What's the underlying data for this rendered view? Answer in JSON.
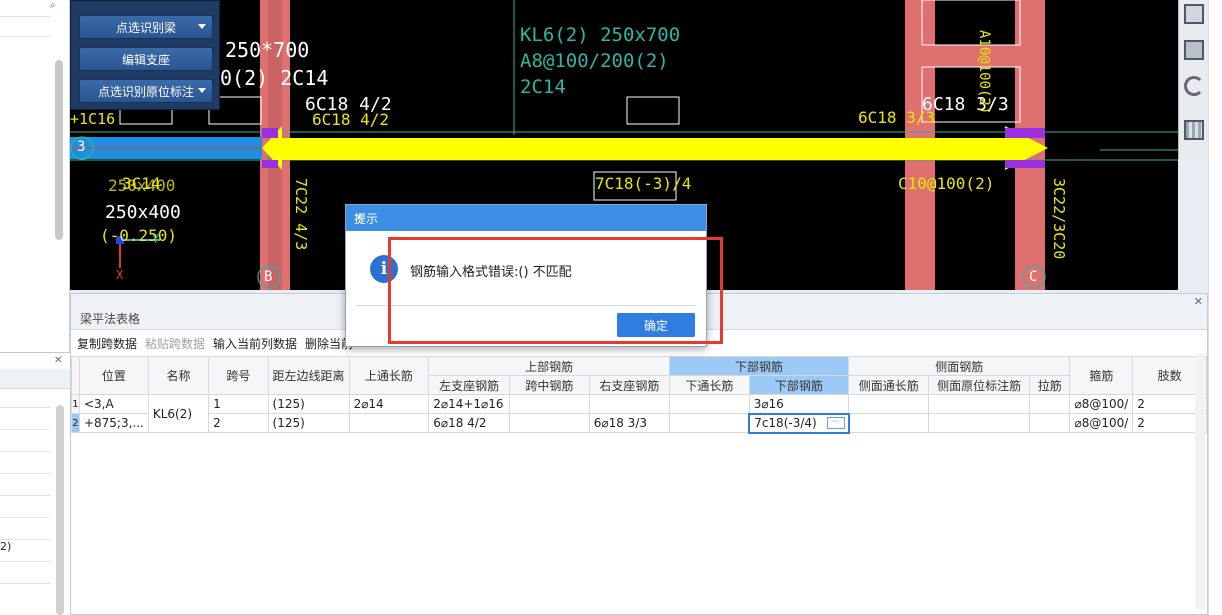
{
  "floating_menu": {
    "items": [
      {
        "label": "点选识别梁",
        "has_dropdown": true
      },
      {
        "label": "编辑支座",
        "has_dropdown": false
      },
      {
        "label": "点选识别原位标注",
        "has_dropdown": true
      }
    ]
  },
  "cad": {
    "texts": {
      "beam_section_white": "250*700",
      "beam_stirrup_white": "0(2) 2C14",
      "beam_kl6": "KL6(2) 250x700",
      "beam_a8": "A8@100/200(2)",
      "beam_2c14": "2C14",
      "support_left_white": "6C18 4/2",
      "support_left_yellow": "6C18 4/2",
      "support_right_white": "6C18 3/3",
      "support_right_yellow": "6C18 3/3",
      "left_1c16": "+1C16",
      "left_section_yellow": "250x400",
      "left_section_white": "250x400",
      "left_elev": "(-0.250)",
      "left_2c14": "3C14",
      "span2_bottom": "7C18(-3)/4",
      "span2_stirrup": "C10@100(2)",
      "col_b_text": "7C22 4/3",
      "col_c_text": "3C22/3C20",
      "col_c_a10": "A10@100(2)",
      "grid_3": "3",
      "grid_b": "B",
      "grid_c": "C",
      "axis_x": "X",
      "axis_y": "Y"
    },
    "colors": {
      "bg": "#000000",
      "highlight_beam": "#ffff00",
      "column": "#e07070",
      "text_yellow": "#e8e800",
      "text_cyan": "#2fb5a3"
    }
  },
  "bottom_panel": {
    "title": "梁平法表格",
    "toolbar": [
      {
        "label": "复制跨数据",
        "enabled": true
      },
      {
        "label": "粘贴跨数据",
        "enabled": false
      },
      {
        "label": "输入当前列数据",
        "enabled": true
      },
      {
        "label": "删除当前",
        "enabled": true
      }
    ],
    "header": {
      "position": "位置",
      "name": "名称",
      "span": "跨号",
      "dist": "距左边线距离",
      "top_through": "上通长筋",
      "top_group": "上部钢筋",
      "left_support": "左支座钢筋",
      "mid_span": "跨中钢筋",
      "right_support": "右支座钢筋",
      "bottom_group": "下部钢筋",
      "bottom_through": "下通长筋",
      "bottom_bars": "下部钢筋",
      "side_group": "侧面钢筋",
      "side_through": "侧面通长筋",
      "side_in_situ": "侧面原位标注筋",
      "tie": "拉筋",
      "stirrup": "箍筋",
      "legs": "肢数"
    },
    "rows": [
      {
        "num": "1",
        "position": "<3,A",
        "name": "KL6(2)",
        "span": "1",
        "dist": "(125)",
        "top_through": "2⌀14",
        "left_support": "2⌀14+1⌀16",
        "mid_span": "",
        "right_support": "",
        "bottom_through": "",
        "bottom_bars": "3⌀16",
        "side_through": "",
        "side_in_situ": "",
        "tie": "",
        "stirrup": "⌀8@100/",
        "legs": "2"
      },
      {
        "num": "2",
        "position": "+875;3,...",
        "name": "",
        "span": "2",
        "dist": "(125)",
        "top_through": "",
        "left_support": "6⌀18 4/2",
        "mid_span": "",
        "right_support": "6⌀18 3/3",
        "bottom_through": "",
        "bottom_bars": "7c18(-3/4)",
        "side_through": "",
        "side_in_situ": "",
        "tie": "",
        "stirrup": "⌀8@100/",
        "legs": "2"
      }
    ]
  },
  "dialog": {
    "title": "提示",
    "close": "×",
    "icon_letter": "i",
    "message": "钢筋输入格式错误:() 不匹配",
    "ok_label": "确定"
  },
  "left_panel": {
    "lower_text": "2)"
  }
}
